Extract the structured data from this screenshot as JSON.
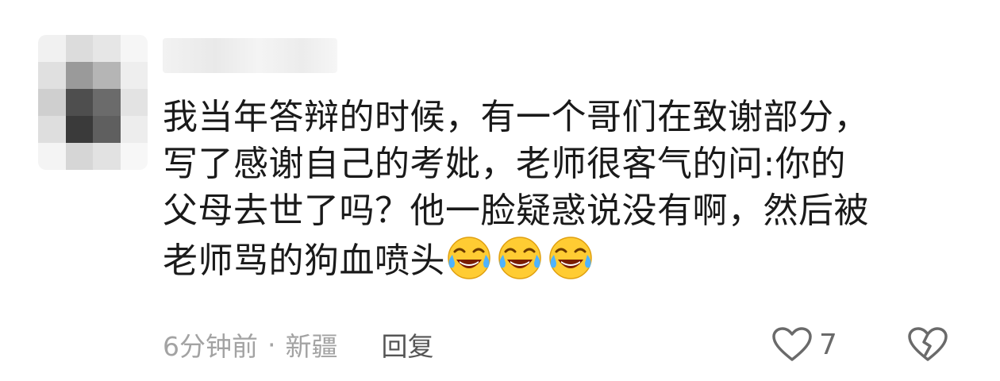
{
  "comment": {
    "lines": [
      "我当年答辩的时候，有一个哥们在致谢部分，",
      "写了感谢自己的考妣，老师很客气的问:你的",
      "父母去世了吗？他一脸疑惑说没有啊，然后被",
      "老师骂的狗血喷头"
    ],
    "emoji": [
      "laugh-cry-emoji",
      "laugh-cry-emoji",
      "laugh-cry-emoji"
    ]
  },
  "meta": {
    "time": "6分钟前",
    "separator": "·",
    "location": "新疆",
    "reply_label": "回复"
  },
  "actions": {
    "like_count": "7",
    "like_icon": "heart-outline-icon",
    "dislike_icon": "broken-heart-icon"
  },
  "colors": {
    "text": "#1a1a1a",
    "meta_text": "#a3a3a3",
    "reply_text": "#555555",
    "icon": "#6a6a6a"
  }
}
